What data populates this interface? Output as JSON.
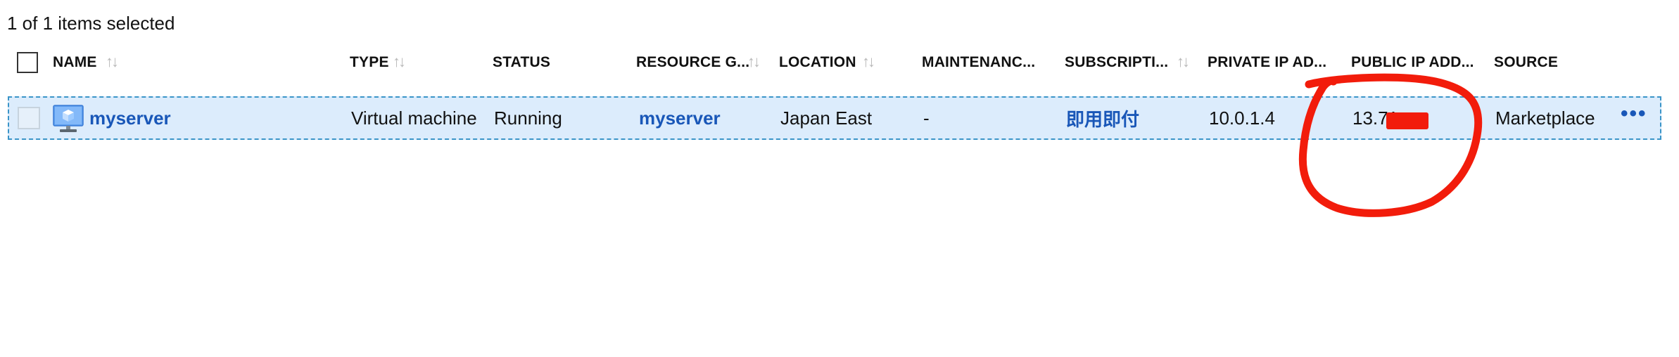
{
  "selection_summary": "1 of 1 items selected",
  "columns": {
    "name": "NAME",
    "type": "TYPE",
    "status": "STATUS",
    "resource_group": "RESOURCE G...",
    "location": "LOCATION",
    "maintenance": "MAINTENANC...",
    "subscription": "SUBSCRIPTI...",
    "private_ip": "PRIVATE IP AD...",
    "public_ip": "PUBLIC IP ADD...",
    "source": "SOURCE"
  },
  "sort_icon": "↑↓",
  "row": {
    "name": "myserver",
    "type": "Virtual machine",
    "status": "Running",
    "resource_group": "myserver",
    "location": "Japan East",
    "maintenance": "-",
    "subscription": "即用即付",
    "private_ip": "10.0.1.4",
    "public_ip": "13.71.",
    "source": "Marketplace",
    "more": "•••",
    "icon": "virtual-machine-icon"
  },
  "colors": {
    "link": "#1957b8",
    "row_selected": "#dcecfc",
    "row_border": "#3a94c8",
    "annotation": "#f21c0b"
  }
}
